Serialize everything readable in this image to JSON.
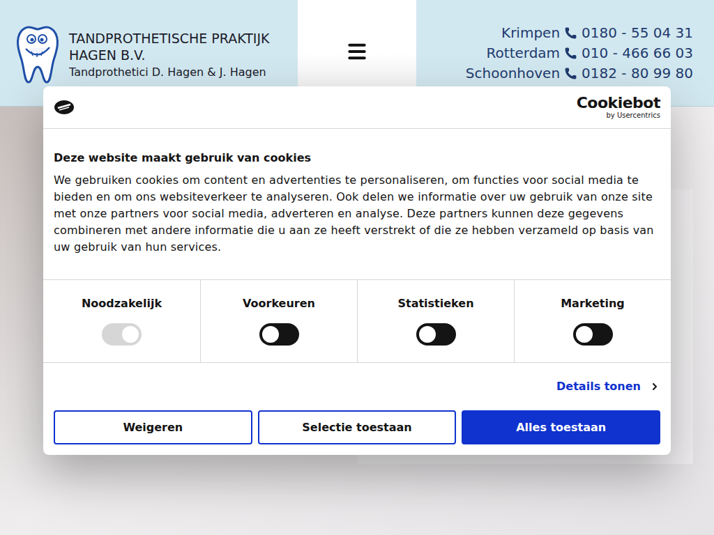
{
  "header": {
    "title_lines": [
      "TANDPROTHETISCHE PRAKTIJK",
      "HAGEN B.V."
    ],
    "subtitle": "Tandprothetici D. Hagen & J. Hagen",
    "phones": [
      {
        "city": "Krimpen",
        "number": "0180 - 55 04 31"
      },
      {
        "city": "Rotterdam",
        "number": "010 - 466 66 03"
      },
      {
        "city": "Schoonhoven",
        "number": "0182 - 80 99 80"
      }
    ]
  },
  "cookie_dialog": {
    "brand": {
      "name": "Cookiebot",
      "by": "by Usercentrics"
    },
    "title": "Deze website maakt gebruik van cookies",
    "text": "We gebruiken cookies om content en advertenties te personaliseren, om functies voor social media te bieden en om ons websiteverkeer te analyseren. Ook delen we informatie over uw gebruik van onze site met onze partners voor social media, adverteren en analyse. Deze partners kunnen deze gegevens combineren met andere informatie die u aan ze heeft verstrekt of die ze hebben verzameld op basis van uw gebruik van hun services.",
    "categories": [
      {
        "label": "Noodzakelijk",
        "on": true,
        "disabled": true
      },
      {
        "label": "Voorkeuren",
        "on": false,
        "disabled": false
      },
      {
        "label": "Statistieken",
        "on": false,
        "disabled": false
      },
      {
        "label": "Marketing",
        "on": false,
        "disabled": false
      }
    ],
    "details_link": "Details tonen",
    "buttons": [
      {
        "label": "Weigeren",
        "primary": false
      },
      {
        "label": "Selectie toestaan",
        "primary": false
      },
      {
        "label": "Alles toestaan",
        "primary": true
      }
    ]
  }
}
